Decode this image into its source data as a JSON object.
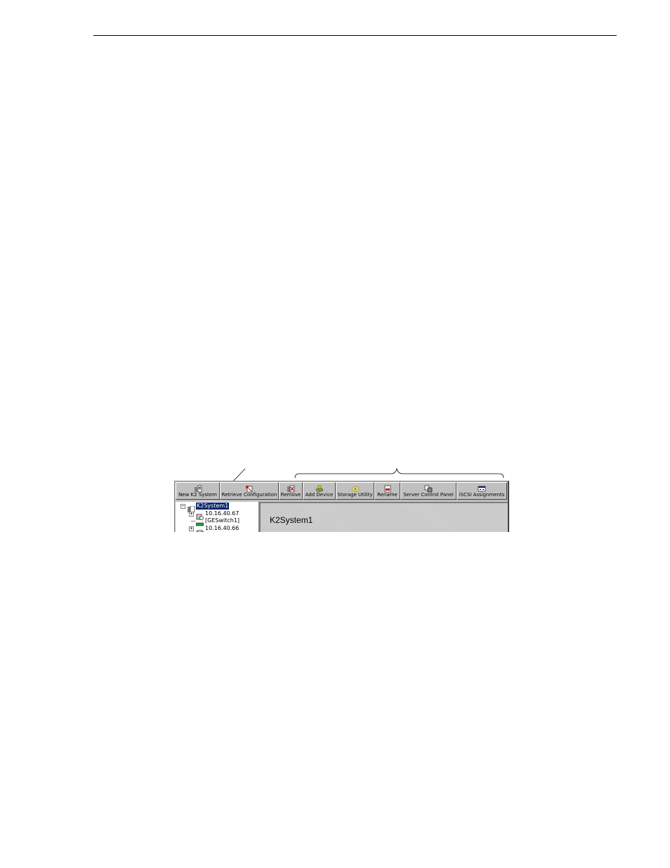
{
  "toolbar": {
    "buttons": [
      {
        "label": "New K2 System",
        "icon": "new-system-icon"
      },
      {
        "label": "Retrieve Configuration",
        "icon": "retrieve-config-icon"
      },
      {
        "label": "Remove",
        "icon": "remove-icon"
      },
      {
        "label": "Add Device",
        "icon": "add-device-icon"
      },
      {
        "label": "Storage Utility",
        "icon": "storage-utility-icon"
      },
      {
        "label": "Rename",
        "icon": "rename-icon"
      },
      {
        "label": "Server Control Panel",
        "icon": "server-control-panel-icon"
      },
      {
        "label": "iSCSI Assignments",
        "icon": "iscsi-assignments-icon"
      }
    ]
  },
  "tree": {
    "root": {
      "label": "K2System1",
      "expander": "−",
      "selected": true
    },
    "items": [
      {
        "label": "10.16.40.67",
        "expander": "+",
        "icon": "server-icon"
      },
      {
        "label": "[GESwitch1]",
        "expander": "",
        "icon": "switch-icon"
      },
      {
        "label": "10.16.40.66",
        "expander": "+",
        "icon": "storage-icon"
      }
    ]
  },
  "content": {
    "title": "K2System1"
  },
  "colors": {
    "selection": "#0a246a",
    "window_face": "#c0c0c0",
    "content_bg": "#cfcfcf"
  }
}
